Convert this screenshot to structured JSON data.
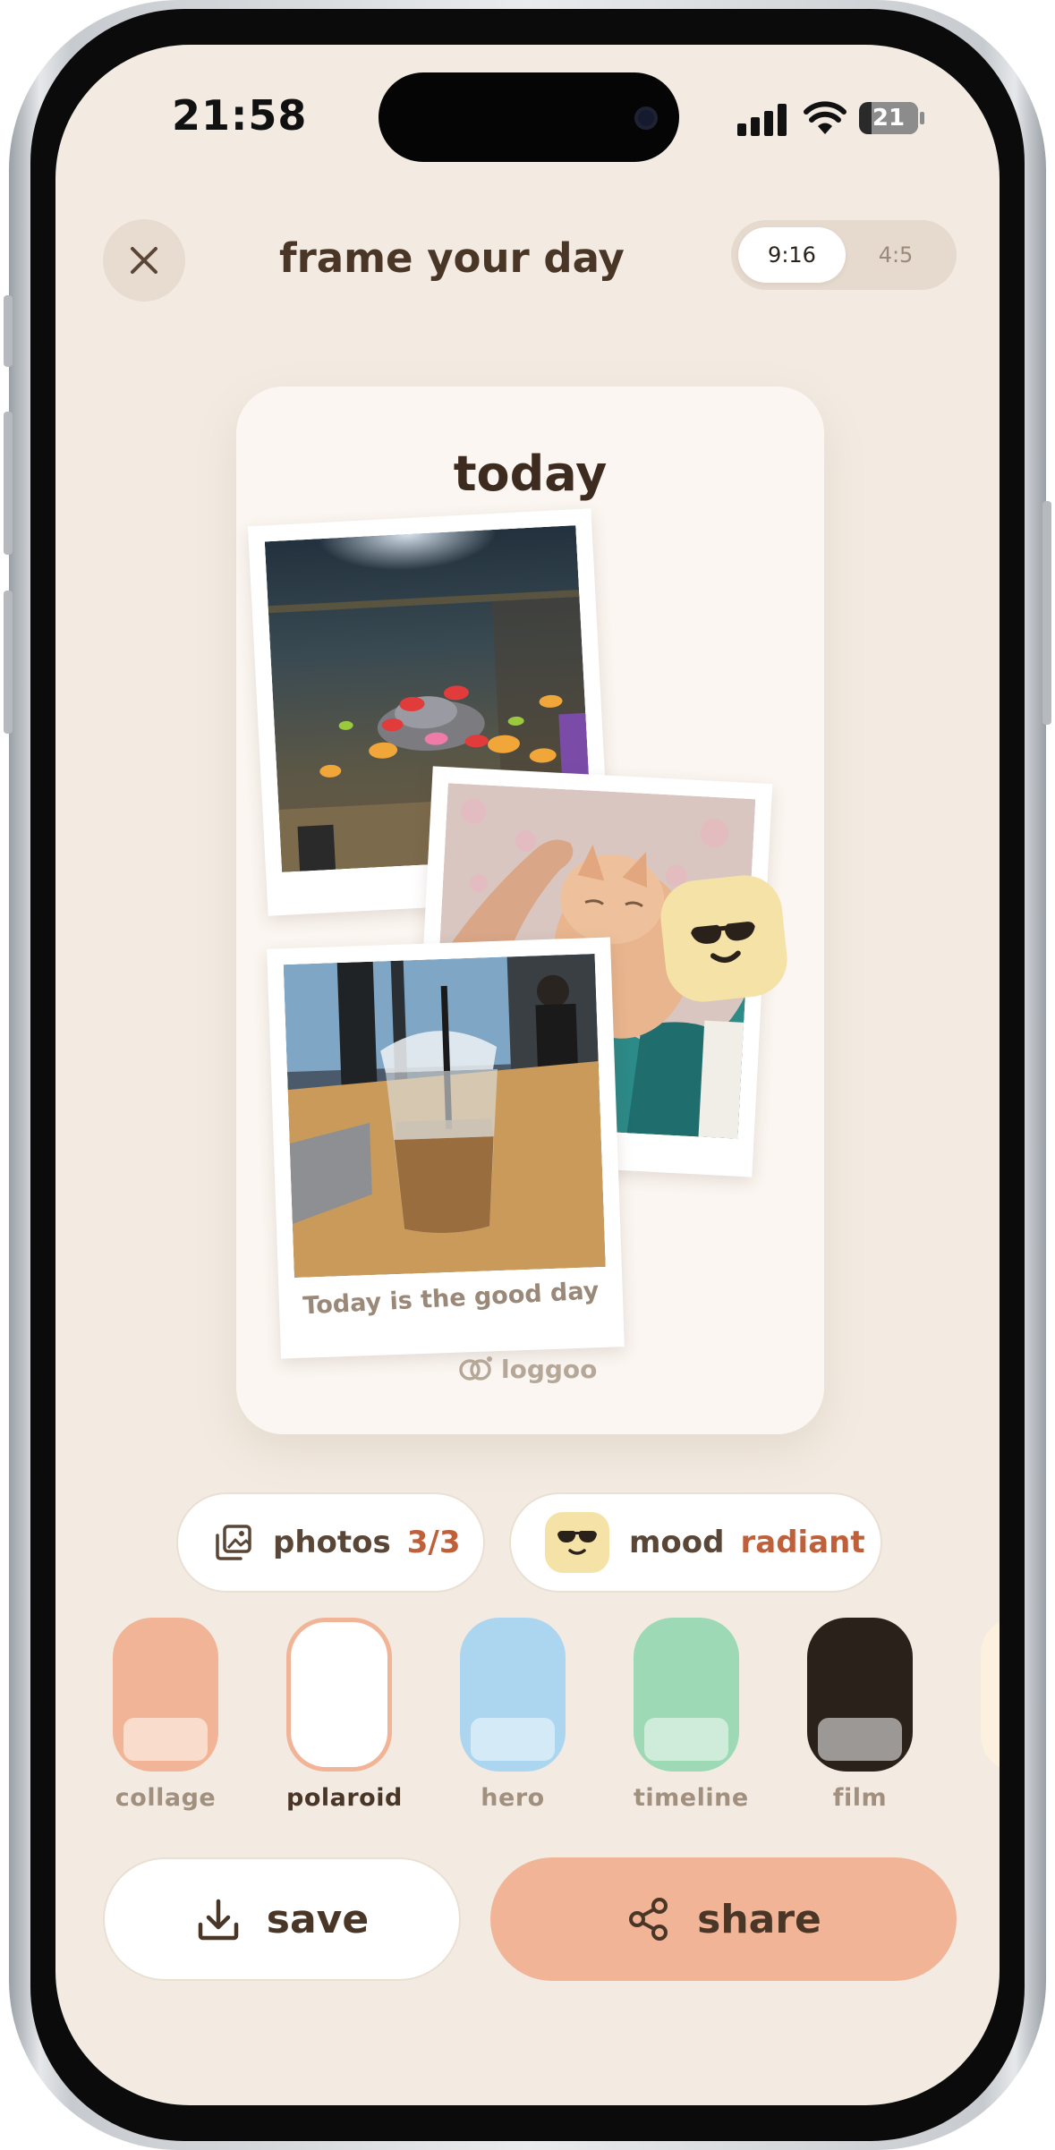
{
  "status_bar": {
    "time": "21:58",
    "battery": "21",
    "battery_level": 0.21
  },
  "header": {
    "title": "frame your day",
    "ratio_options": [
      "9:16",
      "4:5"
    ],
    "selected_ratio": "9:16"
  },
  "card": {
    "title": "today",
    "caption": "Today is the good day",
    "watermark": "loggoo"
  },
  "chips": {
    "photos": {
      "label": "photos",
      "value": "3/3"
    },
    "mood": {
      "label": "mood",
      "value": "radiant"
    }
  },
  "layouts": [
    {
      "label": "collage",
      "color": "#f2b497"
    },
    {
      "label": "polaroid",
      "color": "#ffffff",
      "selected": true
    },
    {
      "label": "hero",
      "color": "#acd5ef"
    },
    {
      "label": "timeline",
      "color": "#9dd9b5"
    },
    {
      "label": "film",
      "color": "#2a211b"
    }
  ],
  "actions": {
    "save": "save",
    "share": "share"
  },
  "colors": {
    "background": "#f3ebe2",
    "accent": "#f2b497",
    "accent_text": "#c0603a",
    "mood_sticker": "#f5e2a6"
  },
  "icons": [
    "close-icon",
    "gallery-icon",
    "sunglasses-face-icon",
    "download-icon",
    "share-icon",
    "loggoo-logo-icon"
  ]
}
